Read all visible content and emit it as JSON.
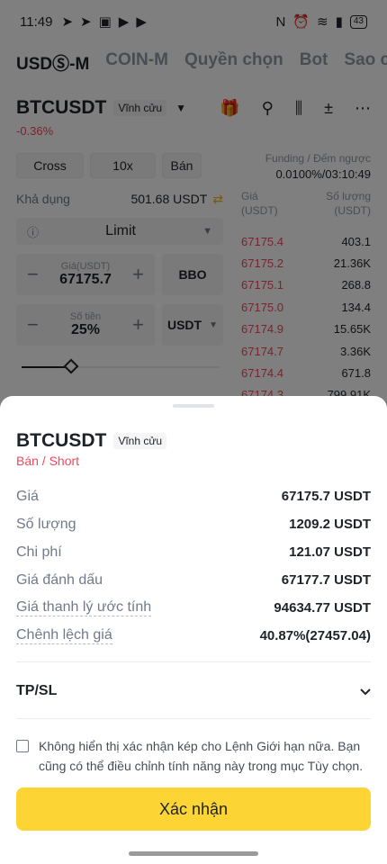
{
  "status_bar": {
    "time": "11:49",
    "battery": "43"
  },
  "top_tabs": [
    "USDⓈ-M",
    "COIN-M",
    "Quyền chọn",
    "Bot",
    "Sao ch"
  ],
  "header": {
    "symbol": "BTCUSDT",
    "tag": "Vĩnh cửu",
    "change": "-0.36%"
  },
  "funding": {
    "label": "Funding / Đếm ngược",
    "value": "0.0100%/03:10:49"
  },
  "controls": {
    "margin_mode": "Cross",
    "leverage": "10x",
    "side": "Bán"
  },
  "available": {
    "label": "Khả dụng",
    "value": "501.68 USDT"
  },
  "order_type": "Limit",
  "price_input": {
    "caption": "Giá(USDT)",
    "value": "67175.7",
    "bbo": "BBO"
  },
  "amount_input": {
    "caption": "Số tiền",
    "value": "25%",
    "unit": "USDT"
  },
  "slider": {
    "level": 0.25
  },
  "order_book": {
    "price_header": "Giá (USDT)",
    "qty_header": "Số lượng (USDT)",
    "rows": [
      {
        "price": "67175.4",
        "qty": "403.1"
      },
      {
        "price": "67175.2",
        "qty": "21.36K"
      },
      {
        "price": "67175.1",
        "qty": "268.8"
      },
      {
        "price": "67175.0",
        "qty": "134.4"
      },
      {
        "price": "67174.9",
        "qty": "15.65K"
      },
      {
        "price": "67174.7",
        "qty": "3.36K"
      },
      {
        "price": "67174.4",
        "qty": "671.8"
      },
      {
        "price": "67174.3",
        "qty": "799.91K"
      }
    ]
  },
  "sheet": {
    "symbol": "BTCUSDT",
    "tag": "Vĩnh cửu",
    "subtitle": "Bán / Short",
    "rows": [
      {
        "label": "Giá",
        "value": "67175.7 USDT"
      },
      {
        "label": "Số lượng",
        "value": "1209.2 USDT"
      },
      {
        "label": "Chi phí",
        "value": "121.07 USDT"
      },
      {
        "label": "Giá đánh dấu",
        "value": "67177.7 USDT"
      },
      {
        "label": "Giá thanh lý ước tính",
        "value": "94634.77 USDT"
      },
      {
        "label": "Chênh lệch giá",
        "value": "40.87%(27457.04)"
      }
    ],
    "tpsl": "TP/SL",
    "note": "Không hiển thị xác nhận kép cho Lệnh Giới hạn nữa. Bạn cũng có thể điều chỉnh tính năng này trong mục Tùy chọn.",
    "confirm": "Xác nhận"
  },
  "colors": {
    "accent": "#fcd535",
    "sell": "#f6465d"
  }
}
